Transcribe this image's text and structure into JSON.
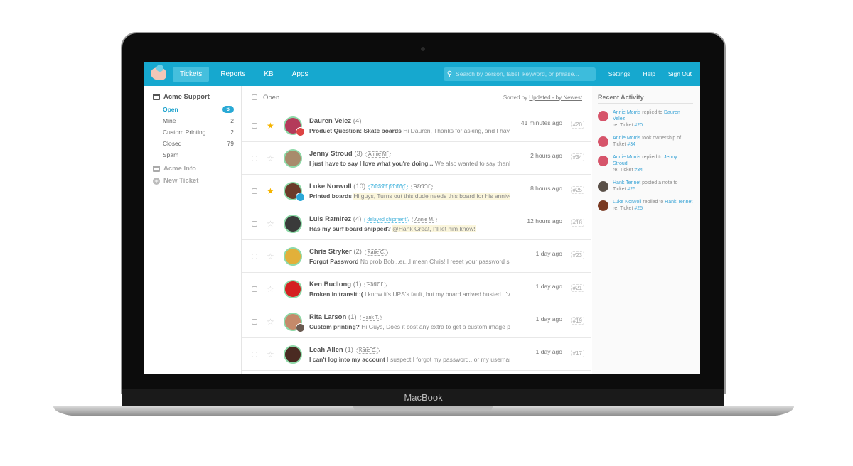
{
  "device_label": "MacBook",
  "nav": {
    "items": [
      "Tickets",
      "Reports",
      "KB",
      "Apps"
    ],
    "active": 0,
    "search_placeholder": "Search by person, label, keyword, or phrase...",
    "right": [
      "Settings",
      "Help",
      "Sign Out"
    ]
  },
  "sidebar": {
    "group1": "Acme Support",
    "items": [
      {
        "label": "Open",
        "count": "6",
        "active": true
      },
      {
        "label": "Mine",
        "count": "2"
      },
      {
        "label": "Custom Printing",
        "count": "2"
      },
      {
        "label": "Closed",
        "count": "79"
      },
      {
        "label": "Spam",
        "count": ""
      }
    ],
    "group2": "Acme Info",
    "new_ticket": "New Ticket"
  },
  "list": {
    "title": "Open",
    "sorted_prefix": "Sorted by ",
    "sorted_link": "Updated - by Newest",
    "rows": [
      {
        "name": "Dauren Velez",
        "count": "(4)",
        "tags": [],
        "subject": "Product Question: Skate boards",
        "snippet": "Hi Dauren, Thanks for asking, and I have so",
        "time": "41 minutes ago",
        "id": "#20",
        "starred": true,
        "sub_avatar": true,
        "avatar_color": "#b43a5a"
      },
      {
        "name": "Jenny Stroud",
        "count": "(3)",
        "tags": [
          {
            "t": "Annie M."
          }
        ],
        "subject": "I just have to say I love what you're doing...",
        "snippet": "We also wanted to say thank you",
        "time": "2 hours ago",
        "id": "#34",
        "starred": false,
        "avatar_color": "#a88b6c"
      },
      {
        "name": "Luke Norwoll",
        "count": "(10)",
        "tags": [
          {
            "t": "custom printing",
            "blue": true
          },
          {
            "t": "Hank T."
          }
        ],
        "subject": "Printed boards",
        "snippet": "Hi guys, Turns out this dude needs this board for his anniversary",
        "highlight": true,
        "time": "8 hours ago",
        "id": "#25",
        "starred": true,
        "sub_avatar": true,
        "sub_color": "#2aa8d8",
        "avatar_color": "#6b3b2a"
      },
      {
        "name": "Luis Ramirez",
        "count": "(4)",
        "tags": [
          {
            "t": "delayed shipment",
            "blue": true
          },
          {
            "t": "Annie M."
          }
        ],
        "subject": "Has my surf board shipped?",
        "snippet": "@Hank Great, I'll let him know!",
        "highlight": true,
        "time": "12 hours ago",
        "id": "#18",
        "starred": false,
        "avatar_color": "#3a3a3a"
      },
      {
        "name": "Chris Stryker",
        "count": "(2)",
        "tags": [
          {
            "t": "Katie C."
          }
        ],
        "subject": "Forgot Password",
        "snippet": "No prob Bob...er...I mean Chris! I reset your password so you sh",
        "time": "1 day ago",
        "id": "#23",
        "starred": false,
        "avatar_color": "#e2b03a"
      },
      {
        "name": "Ken Budlong",
        "count": "(1)",
        "tags": [
          {
            "t": "Hank T."
          }
        ],
        "subject": "Broken in transit :(",
        "snippet": "I know it's UPS's fault, but my board arrived busted. I've attach",
        "time": "1 day ago",
        "id": "#21",
        "starred": false,
        "avatar_color": "#d42020"
      },
      {
        "name": "Rita Larson",
        "count": "(1)",
        "tags": [
          {
            "t": "Hank T."
          }
        ],
        "subject": "Custom printing?",
        "snippet": "Hi Guys, Does it cost any extra to get a custom image printed on",
        "time": "1 day ago",
        "id": "#19",
        "starred": false,
        "sub_avatar": true,
        "sub_color": "#6a5a50",
        "avatar_color": "#c58a6a"
      },
      {
        "name": "Leah Allen",
        "count": "(1)",
        "tags": [
          {
            "t": "Katie C."
          }
        ],
        "subject": "I can't log into my account",
        "snippet": "I suspect I forgot my password...or my username...I do",
        "time": "1 day ago",
        "id": "#17",
        "starred": false,
        "avatar_color": "#4a2a22"
      }
    ]
  },
  "activity": {
    "title": "Recent Activity",
    "items": [
      {
        "actor": "Annie Morris",
        "action": " replied to ",
        "target": "Dauren Velez",
        "line2": "re: Ticket ",
        "ticket": "#20",
        "color": "#d6546a"
      },
      {
        "actor": "Annie Morris",
        "action": " took ownership of",
        "target": "",
        "line2": "Ticket ",
        "ticket": "#34",
        "color": "#d6546a"
      },
      {
        "actor": "Annie Morris",
        "action": " replied to ",
        "target": "Jenny Stroud",
        "line2": "re: Ticket ",
        "ticket": "#34",
        "color": "#d6546a"
      },
      {
        "actor": "Hank Tennet",
        "action": " posted a note to",
        "target": "",
        "line2": "Ticket ",
        "ticket": "#25",
        "color": "#5a5048"
      },
      {
        "actor": "Luke Norwoll",
        "action": " replied to ",
        "target": "Hank Tennet",
        "line2": "re: Ticket ",
        "ticket": "#25",
        "color": "#7a3a22"
      }
    ]
  },
  "colors": {
    "header": "#16a8cf",
    "accent": "#29a9d5",
    "star": "#f5b400"
  }
}
